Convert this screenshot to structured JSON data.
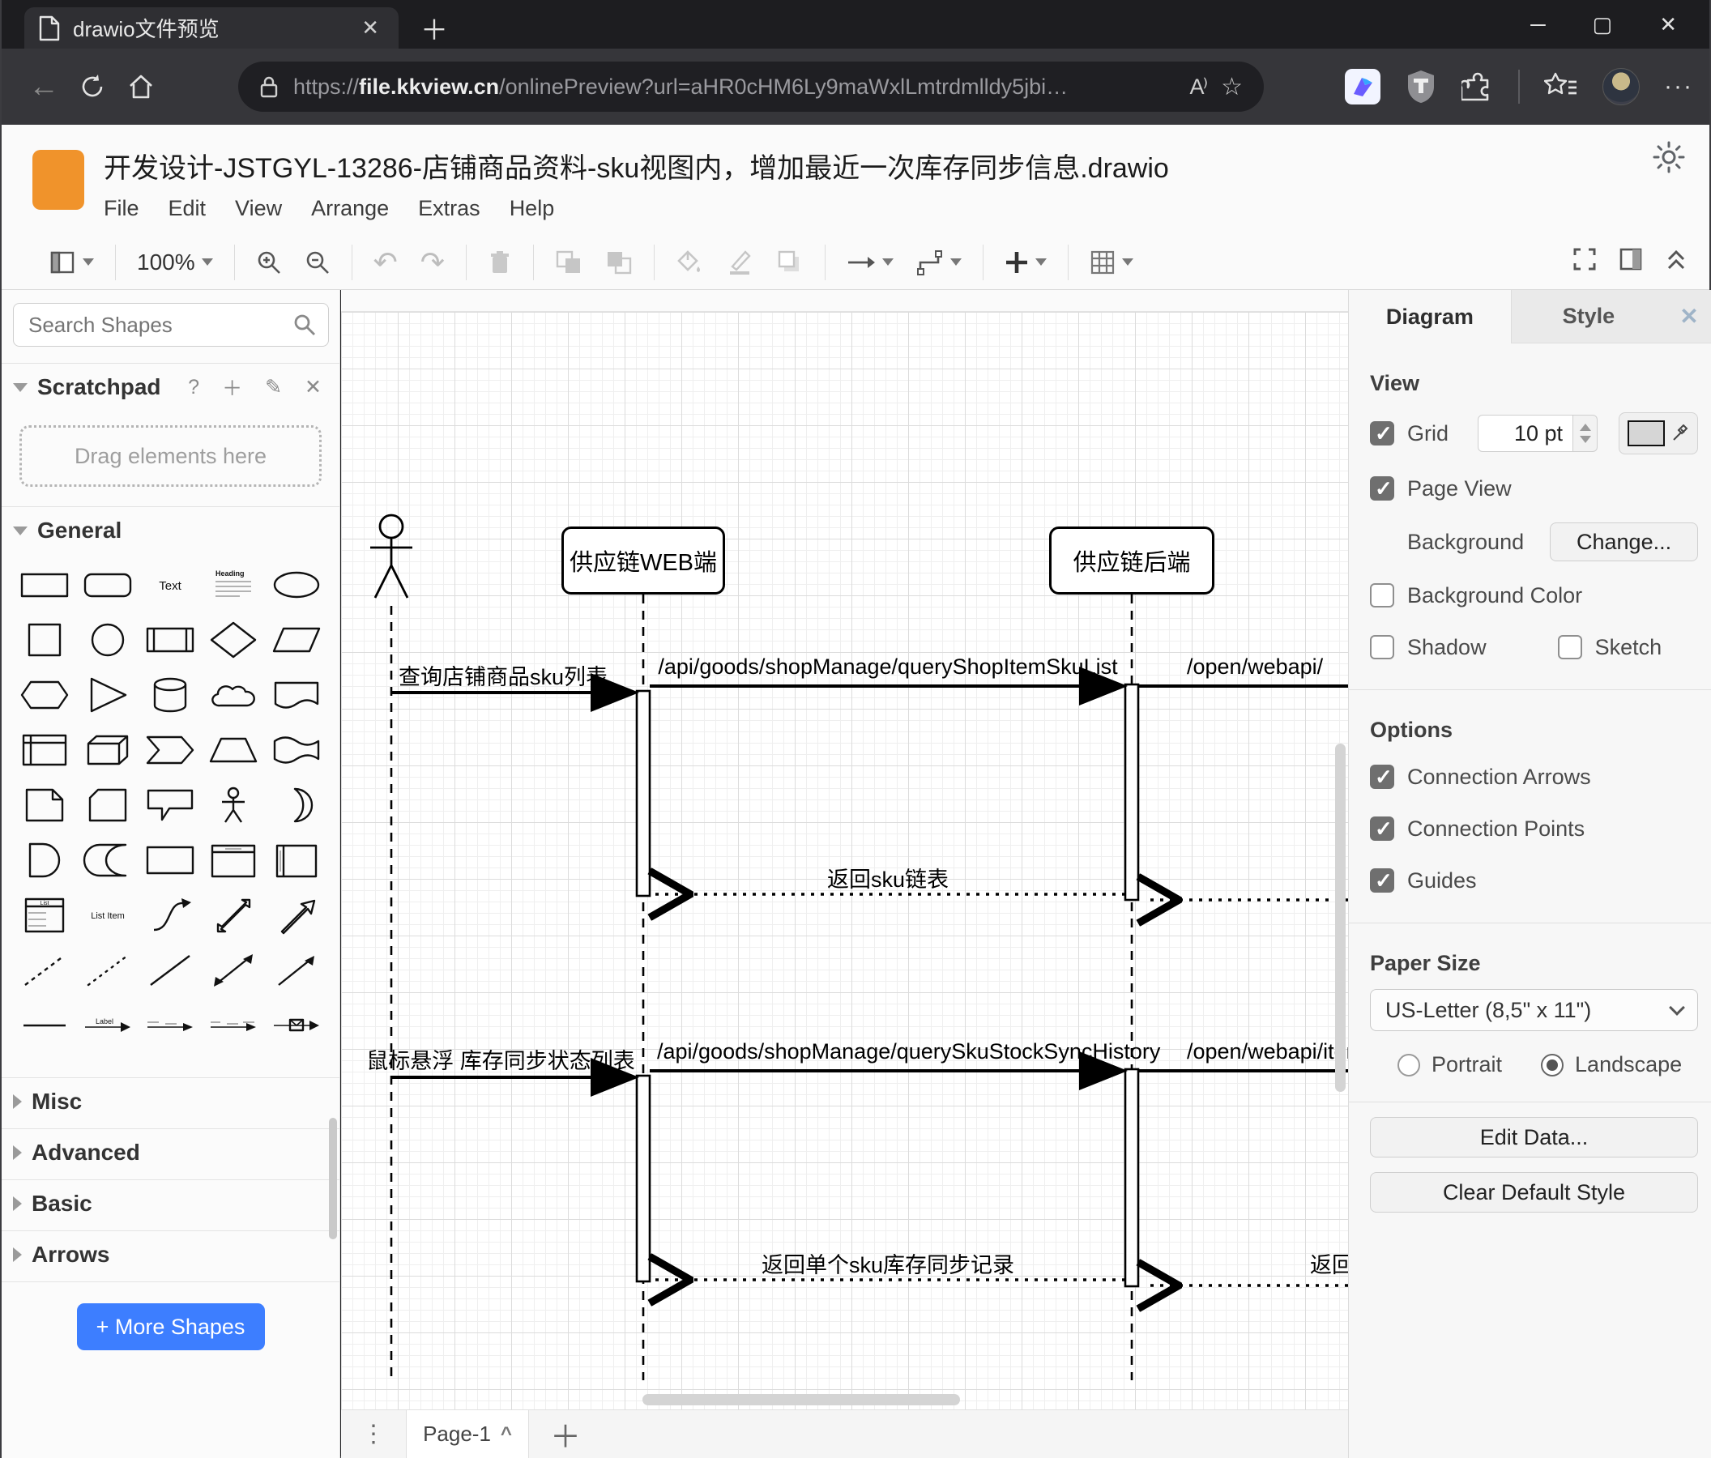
{
  "colors": {
    "accent_blue": "#3d7eff",
    "logo_orange": "#f0932b",
    "chrome_dark": "#1d1d20",
    "chrome_mid": "#36363a"
  },
  "glyphs": {
    "close": "✕",
    "plus": "＋",
    "minimize": "─",
    "maximize": "▢",
    "back": "←",
    "star": "☆",
    "more": "···",
    "dots": "⋮",
    "caret_up": "^",
    "undo": "↶",
    "redo": "↷",
    "question": "?",
    "pencil": "✎",
    "read_aloud": "A⁾"
  },
  "browser": {
    "tab": {
      "title": "drawio文件预览"
    },
    "address": {
      "scheme": "https://",
      "host": "file.kkview.cn",
      "path": "/onlinePreview?url=aHR0cHM6Ly9maWxlLmtrdmlldy5jbi…"
    },
    "icon_names": [
      "document-icon",
      "close-icon",
      "new-tab-icon",
      "back-icon",
      "refresh-icon",
      "home-icon",
      "lock-icon",
      "read-aloud-icon",
      "favorite-star-icon",
      "bird-extension-icon",
      "tampermonkey-icon",
      "extensions-puzzle-icon",
      "collections-icon",
      "profile-avatar",
      "more-menu-icon",
      "minimize-icon",
      "maximize-icon",
      "window-close-icon"
    ]
  },
  "app": {
    "title": "开发设计-JSTGYL-13286-店铺商品资料-sku视图内，增加最近一次库存同步信息.drawio",
    "menus": [
      "File",
      "Edit",
      "View",
      "Arrange",
      "Extras",
      "Help"
    ],
    "toolbar": {
      "zoom": "100%"
    }
  },
  "sidebar": {
    "search_placeholder": "Search Shapes",
    "scratchpad": {
      "title": "Scratchpad",
      "hint": "Drag elements here"
    },
    "sections": {
      "general": "General",
      "misc": "Misc",
      "advanced": "Advanced",
      "basic": "Basic",
      "arrows": "Arrows"
    },
    "labels": {
      "text": "Text",
      "heading": "Heading",
      "list": "List",
      "list_item": "List Item",
      "link_label": "Label"
    },
    "more_shapes": "+ More Shapes"
  },
  "canvas": {
    "participants": [
      {
        "label": "供应链WEB端"
      },
      {
        "label": "供应链后端"
      }
    ],
    "messages": {
      "m1": "查询店铺商品sku列表",
      "m2": "/api/goods/shopManage/queryShopItemSkuList",
      "m2b": "/open/webapi/",
      "r1": "返回sku链表",
      "m3": "鼠标悬浮 库存同步状态列表",
      "m4": "/api/goods/shopManage/querySkuStockSyncHistory",
      "m4b": "/open/webapi/item",
      "r2": "返回单个sku库存同步记录",
      "r2b": "返回"
    }
  },
  "panel": {
    "tabs": {
      "diagram": "Diagram",
      "style": "Style"
    },
    "view": {
      "title": "View",
      "grid": "Grid",
      "grid_size": "10 pt",
      "page_view": "Page View",
      "background": "Background",
      "change": "Change...",
      "background_color": "Background Color",
      "shadow": "Shadow",
      "sketch": "Sketch"
    },
    "options": {
      "title": "Options",
      "connection_arrows": "Connection Arrows",
      "connection_points": "Connection Points",
      "guides": "Guides"
    },
    "paper": {
      "title": "Paper Size",
      "size": "US-Letter (8,5\" x 11\")",
      "portrait": "Portrait",
      "landscape": "Landscape"
    },
    "actions": {
      "edit_data": "Edit Data...",
      "clear_default": "Clear Default Style"
    }
  },
  "footer": {
    "page": "Page-1"
  }
}
